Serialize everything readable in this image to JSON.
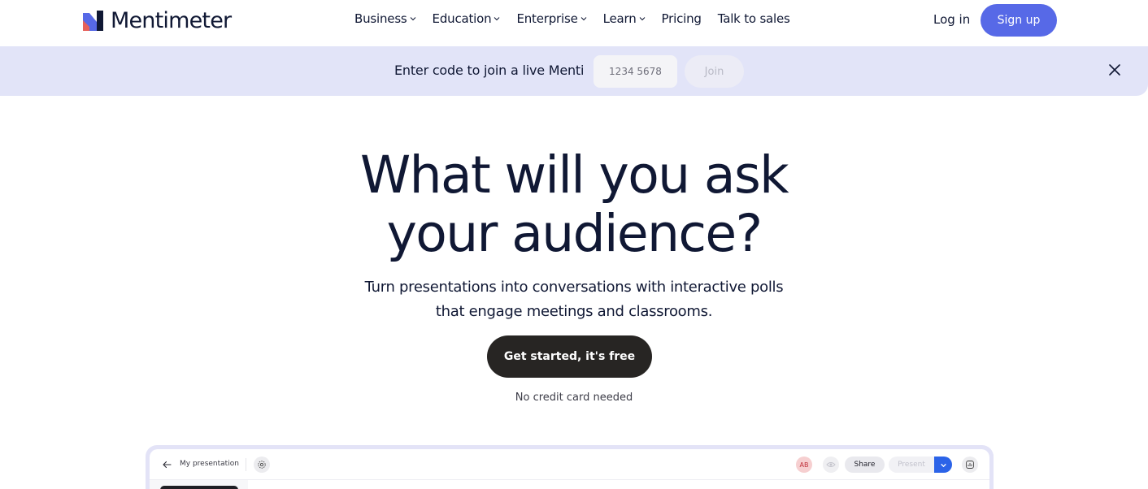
{
  "brand": {
    "name": "Mentimeter",
    "logo_colors": [
      "#e7615a",
      "#5769e7",
      "#101834"
    ]
  },
  "nav": {
    "items": [
      {
        "label": "Business",
        "has_dropdown": true
      },
      {
        "label": "Education",
        "has_dropdown": true
      },
      {
        "label": "Enterprise",
        "has_dropdown": true
      },
      {
        "label": "Learn",
        "has_dropdown": true
      },
      {
        "label": "Pricing",
        "has_dropdown": false
      },
      {
        "label": "Talk to sales",
        "has_dropdown": false
      }
    ],
    "login_label": "Log in",
    "signup_label": "Sign up",
    "accent": "#5769e7"
  },
  "banner": {
    "text": "Enter code to join a live Menti",
    "code_placeholder": "1234 5678",
    "join_label": "Join",
    "close_icon": "close-icon",
    "background": "#e2e4f8"
  },
  "hero": {
    "title_line1": "What will you ask",
    "title_line2": "your audience?",
    "subtitle_line1": "Turn presentations into conversations with interactive polls",
    "subtitle_line2": "that engage meetings and classrooms.",
    "cta_label": "Get started, it's free",
    "note": "No credit card needed"
  },
  "preview": {
    "title": "My presentation",
    "avatar_initials": "AB",
    "share_label": "Share",
    "present_label": "Present",
    "icons": [
      "back-arrow-icon",
      "settings-icon",
      "eye-icon",
      "chevron-down-icon",
      "results-icon"
    ]
  }
}
